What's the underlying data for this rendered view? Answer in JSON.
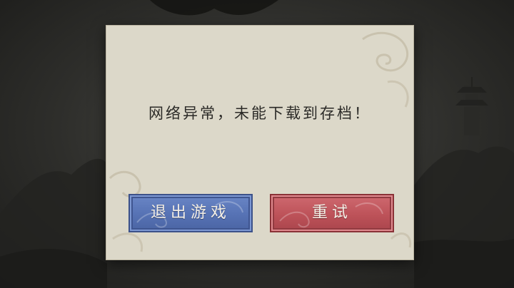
{
  "dialog": {
    "message": "网络异常，未能下载到存档！",
    "buttons": {
      "quit_label": "退出游戏",
      "retry_label": "重试"
    }
  },
  "colors": {
    "paper": "#dcd8c9",
    "quit_button": "#5672b4",
    "retry_button": "#bd5259",
    "backdrop": "#2e2e2b"
  }
}
